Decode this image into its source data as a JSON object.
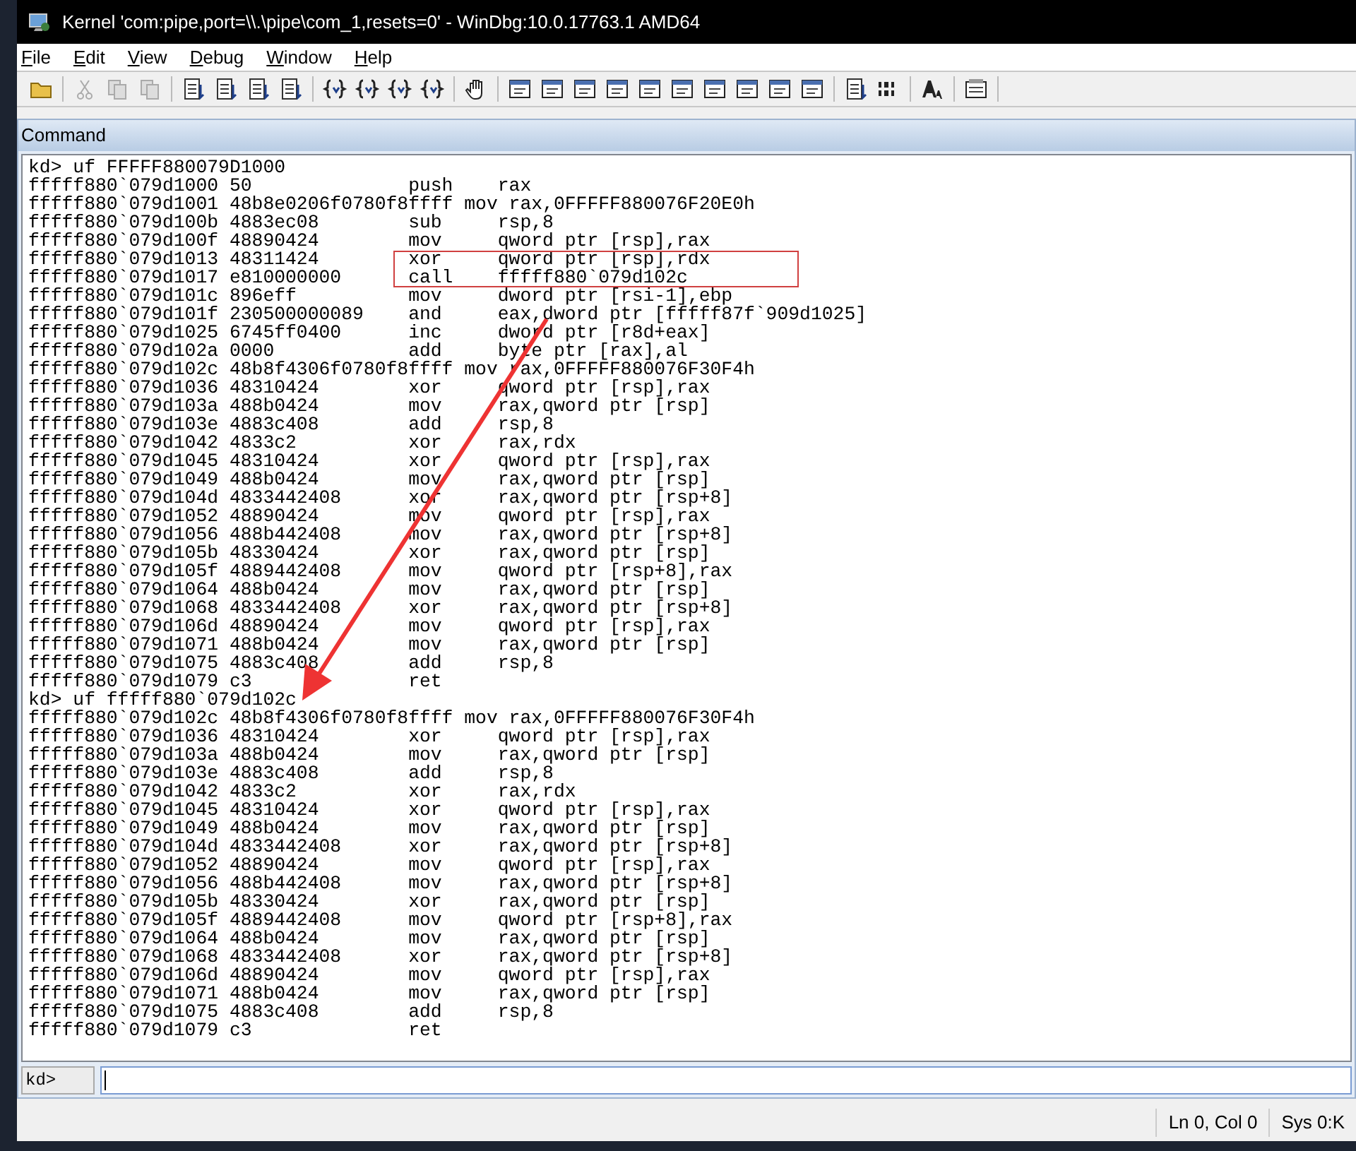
{
  "window": {
    "title": "Kernel 'com:pipe,port=\\\\.\\pipe\\com_1,resets=0' - WinDbg:10.0.17763.1 AMD64"
  },
  "menu": [
    "File",
    "Edit",
    "View",
    "Debug",
    "Window",
    "Help"
  ],
  "pane": {
    "title": "Command"
  },
  "output": [
    "kd> uf FFFFF880079D1000",
    "fffff880`079d1000 50              push    rax",
    "fffff880`079d1001 48b8e0206f0780f8ffff mov rax,0FFFFF880076F20E0h",
    "fffff880`079d100b 4883ec08        sub     rsp,8",
    "fffff880`079d100f 48890424        mov     qword ptr [rsp],rax",
    "fffff880`079d1013 48311424        xor     qword ptr [rsp],rdx",
    "fffff880`079d1017 e810000000      call    fffff880`079d102c",
    "fffff880`079d101c 896eff          mov     dword ptr [rsi-1],ebp",
    "fffff880`079d101f 230500000089    and     eax,dword ptr [fffff87f`909d1025]",
    "fffff880`079d1025 6745ff0400      inc     dword ptr [r8d+eax]",
    "fffff880`079d102a 0000            add     byte ptr [rax],al",
    "fffff880`079d102c 48b8f4306f0780f8ffff mov rax,0FFFFF880076F30F4h",
    "fffff880`079d1036 48310424        xor     qword ptr [rsp],rax",
    "fffff880`079d103a 488b0424        mov     rax,qword ptr [rsp]",
    "fffff880`079d103e 4883c408        add     rsp,8",
    "fffff880`079d1042 4833c2          xor     rax,rdx",
    "fffff880`079d1045 48310424        xor     qword ptr [rsp],rax",
    "fffff880`079d1049 488b0424        mov     rax,qword ptr [rsp]",
    "fffff880`079d104d 4833442408      xor     rax,qword ptr [rsp+8]",
    "fffff880`079d1052 48890424        mov     qword ptr [rsp],rax",
    "fffff880`079d1056 488b442408      mov     rax,qword ptr [rsp+8]",
    "fffff880`079d105b 48330424        xor     rax,qword ptr [rsp]",
    "fffff880`079d105f 4889442408      mov     qword ptr [rsp+8],rax",
    "fffff880`079d1064 488b0424        mov     rax,qword ptr [rsp]",
    "fffff880`079d1068 4833442408      xor     rax,qword ptr [rsp+8]",
    "fffff880`079d106d 48890424        mov     qword ptr [rsp],rax",
    "fffff880`079d1071 488b0424        mov     rax,qword ptr [rsp]",
    "fffff880`079d1075 4883c408        add     rsp,8",
    "fffff880`079d1079 c3              ret",
    "kd> uf fffff880`079d102c",
    "fffff880`079d102c 48b8f4306f0780f8ffff mov rax,0FFFFF880076F30F4h",
    "fffff880`079d1036 48310424        xor     qword ptr [rsp],rax",
    "fffff880`079d103a 488b0424        mov     rax,qword ptr [rsp]",
    "fffff880`079d103e 4883c408        add     rsp,8",
    "fffff880`079d1042 4833c2          xor     rax,rdx",
    "fffff880`079d1045 48310424        xor     qword ptr [rsp],rax",
    "fffff880`079d1049 488b0424        mov     rax,qword ptr [rsp]",
    "fffff880`079d104d 4833442408      xor     rax,qword ptr [rsp+8]",
    "fffff880`079d1052 48890424        mov     qword ptr [rsp],rax",
    "fffff880`079d1056 488b442408      mov     rax,qword ptr [rsp+8]",
    "fffff880`079d105b 48330424        xor     rax,qword ptr [rsp]",
    "fffff880`079d105f 4889442408      mov     qword ptr [rsp+8],rax",
    "fffff880`079d1064 488b0424        mov     rax,qword ptr [rsp]",
    "fffff880`079d1068 4833442408      xor     rax,qword ptr [rsp+8]",
    "fffff880`079d106d 48890424        mov     qword ptr [rsp],rax",
    "fffff880`079d1071 488b0424        mov     rax,qword ptr [rsp]",
    "fffff880`079d1075 4883c408        add     rsp,8",
    "fffff880`079d1079 c3              ret"
  ],
  "prompt": {
    "label": "kd>"
  },
  "status_bar": [
    "Ln 0, Col 0",
    "Sys 0:K"
  ]
}
